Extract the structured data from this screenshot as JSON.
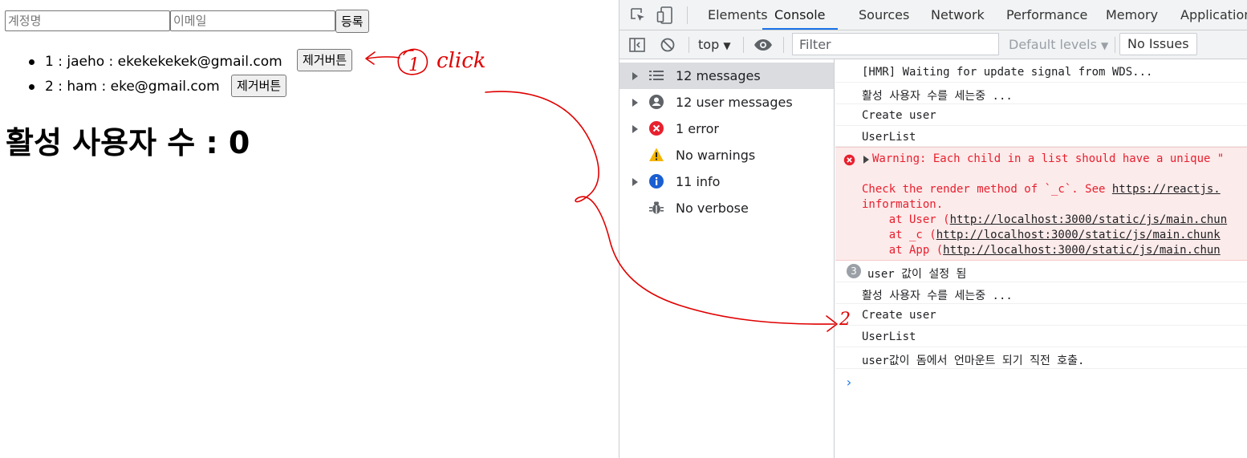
{
  "app": {
    "account_placeholder": "계정명",
    "email_placeholder": "이메일",
    "register_label": "등록",
    "users": [
      {
        "text": "1 : jaeho : ekekekekek@gmail.com",
        "remove_label": "제거버튼"
      },
      {
        "text": "2 : ham : eke@gmail.com",
        "remove_label": "제거버튼"
      }
    ],
    "active_count_text": "활성 사용자 수 : 0"
  },
  "annotation": {
    "step1": "1",
    "click": "click",
    "step2": "2"
  },
  "devtools": {
    "tabs": [
      "Elements",
      "Console",
      "Sources",
      "Network",
      "Performance",
      "Memory",
      "Application"
    ],
    "active_tab": "Console",
    "toolbar": {
      "context": "top",
      "filter_placeholder": "Filter",
      "levels": "Default levels",
      "issues": "No Issues"
    },
    "sidebar": [
      {
        "label": "12 messages",
        "icon": "list-icon"
      },
      {
        "label": "12 user messages",
        "icon": "user-icon"
      },
      {
        "label": "1 error",
        "icon": "error-icon"
      },
      {
        "label": "No warnings",
        "icon": "warning-icon"
      },
      {
        "label": "11 info",
        "icon": "info-icon"
      },
      {
        "label": "No verbose",
        "icon": "bug-icon"
      }
    ],
    "console": {
      "lines_before": [
        "[HMR] Waiting for update signal from WDS...",
        "활성 사용자 수를 세는중 ...",
        "Create user",
        "UserList"
      ],
      "warning": {
        "line1": "Warning: Each child in a list should have a unique \"",
        "line2a": "Check the render method of `_c`. See ",
        "line2_link": "https://reactjs.",
        "line3": "information.",
        "stack": [
          {
            "prefix": "    at User (",
            "link": "http://localhost:3000/static/js/main.chun"
          },
          {
            "prefix": "    at _c (",
            "link": "http://localhost:3000/static/js/main.chunk"
          },
          {
            "prefix": "    at App (",
            "link": "http://localhost:3000/static/js/main.chun"
          }
        ]
      },
      "repeat_count": "3",
      "repeat_text": "user 값이 설정 됨",
      "lines_after": [
        "활성 사용자 수를 세는중 ...",
        "Create user",
        "UserList",
        "user값이 돔에서 언마운트 되기 직전 호출."
      ],
      "prompt": "›"
    }
  },
  "colors": {
    "accent": "#1a73e8",
    "error": "#e8202e",
    "annotation": "#e00000"
  }
}
